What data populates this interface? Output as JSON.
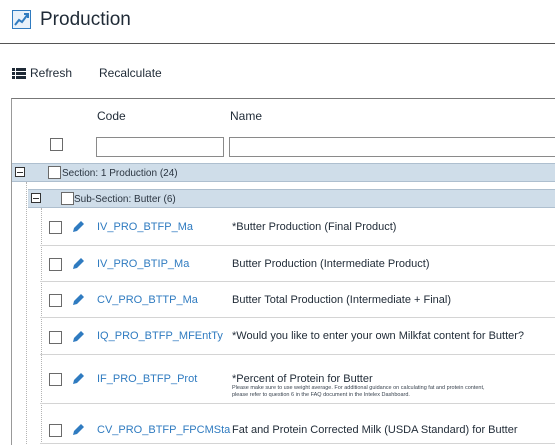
{
  "header": {
    "title": "Production",
    "icon": "chart-up-icon",
    "accent": "#2f7bc0"
  },
  "toolbar": {
    "refresh_label": "Refresh",
    "recalculate_label": "Recalculate"
  },
  "grid": {
    "columns": {
      "code": "Code",
      "name": "Name"
    },
    "filters": {
      "code_value": "",
      "name_value": ""
    },
    "section": {
      "label": "Section: 1 Production (24)"
    },
    "subsection": {
      "label": "Sub-Section: Butter (6)"
    },
    "rows": [
      {
        "code": "IV_PRO_BTFP_Ma",
        "name": "*Butter Production (Final Product)"
      },
      {
        "code": "IV_PRO_BTIP_Ma",
        "name": "Butter Production (Intermediate Product)"
      },
      {
        "code": "CV_PRO_BTTP_Ma",
        "name": "Butter Total Production (Intermediate + Final)"
      },
      {
        "code": "IQ_PRO_BTFP_MFEntTy",
        "name": "*Would you like to enter your own Milkfat content for Butter?"
      },
      {
        "code": "IF_PRO_BTFP_Prot",
        "name": "*Percent of Protein for Butter",
        "note_line1": "Please make sure to use weight average. For additional guidance on calculating fat and protein content,",
        "note_line2": "please refer to question 6 in the FAQ document in the Intelex Dashboard."
      },
      {
        "code": "CV_PRO_BTFP_FPCMSta",
        "name": "Fat and Protein Corrected Milk (USDA Standard) for Butter"
      }
    ]
  }
}
